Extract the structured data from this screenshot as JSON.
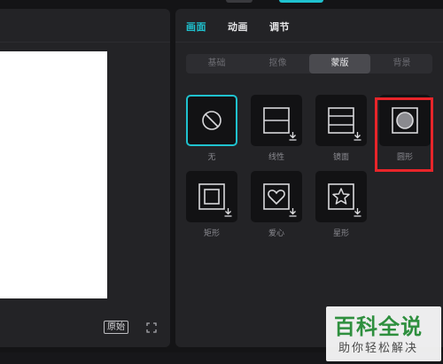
{
  "preview": {
    "ratio_label": "原始"
  },
  "props": {
    "main_tabs": [
      {
        "label": "画面",
        "active": true
      },
      {
        "label": "动画",
        "active": false
      },
      {
        "label": "调节",
        "active": false
      }
    ],
    "sub_tabs": [
      {
        "label": "基础",
        "active": false
      },
      {
        "label": "抠像",
        "active": false
      },
      {
        "label": "蒙版",
        "active": true
      },
      {
        "label": "背景",
        "active": false
      }
    ],
    "masks": [
      {
        "label": "无",
        "icon": "none-icon",
        "selected": true
      },
      {
        "label": "线性",
        "icon": "linear-mask-icon",
        "download": true
      },
      {
        "label": "镜面",
        "icon": "mirror-mask-icon",
        "download": true
      },
      {
        "label": "圆形",
        "icon": "circle-mask-icon",
        "highlighted": true
      },
      {
        "label": "矩形",
        "icon": "rectangle-mask-icon",
        "download": true
      },
      {
        "label": "爱心",
        "icon": "heart-mask-icon",
        "download": true
      },
      {
        "label": "星形",
        "icon": "star-mask-icon",
        "download": true
      }
    ]
  },
  "watermark": {
    "title": "百科全说",
    "subtitle": "助你轻松解决"
  },
  "colors": {
    "accent": "#1fc2cf",
    "highlight": "#e8252a",
    "panel_bg": "#232326",
    "app_bg": "#141416"
  }
}
